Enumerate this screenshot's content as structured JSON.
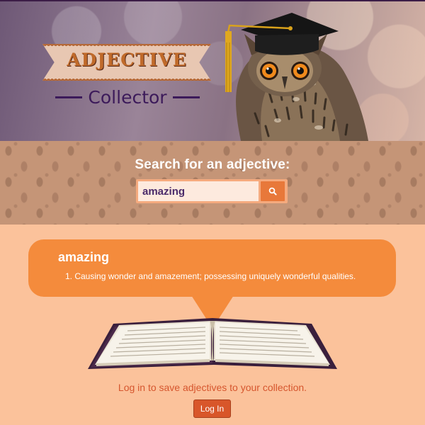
{
  "header": {
    "logo_title": "ADJECTIVE",
    "logo_subtitle": "Collector"
  },
  "search": {
    "label": "Search for an adjective:",
    "value": "amazing",
    "button_icon": "search-icon"
  },
  "result": {
    "word": "amazing",
    "definitions": [
      "1. Causing wonder and amazement; possessing uniquely wonderful qualities."
    ]
  },
  "login": {
    "message": "Log in to save adjectives to your collection.",
    "button_label": "Log In"
  },
  "colors": {
    "accent_orange": "#f48b3c",
    "login_button": "#d8562a",
    "page_background": "#fbc29b",
    "logo_purple": "#3c1a5a"
  }
}
